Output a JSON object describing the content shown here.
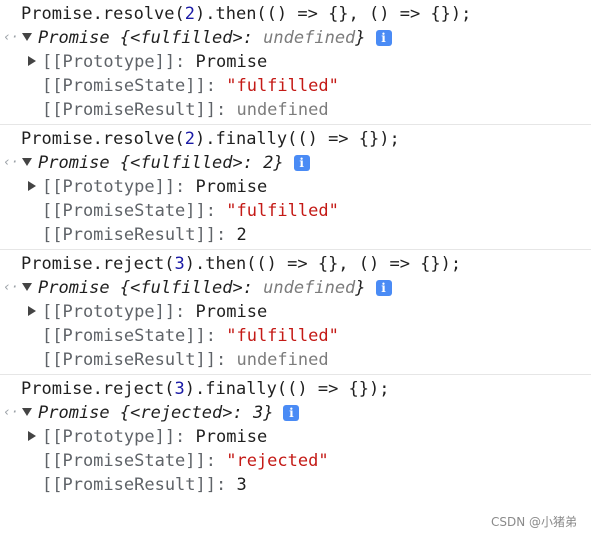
{
  "entries": [
    {
      "input_pre": "Promise.resolve(",
      "input_num": "2",
      "input_post": ").then(() => {}, () => {});",
      "result_prefix": "Promise {<fulfilled>: ",
      "result_value": "undefined",
      "result_suffix": "}",
      "prototype_key": "[[Prototype]]: ",
      "prototype_value": "Promise",
      "state_key": "[[PromiseState]]: ",
      "state_value": "\"fulfilled\"",
      "result_key": "[[PromiseResult]]: ",
      "result_val": "undefined"
    },
    {
      "input_pre": "Promise.resolve(",
      "input_num": "2",
      "input_post": ").finally(() => {});",
      "result_prefix": "Promise {<fulfilled>: ",
      "result_value": "2",
      "result_suffix": "}",
      "prototype_key": "[[Prototype]]: ",
      "prototype_value": "Promise",
      "state_key": "[[PromiseState]]: ",
      "state_value": "\"fulfilled\"",
      "result_key": "[[PromiseResult]]: ",
      "result_val": "2"
    },
    {
      "input_pre": "Promise.reject(",
      "input_num": "3",
      "input_post": ").then(() => {}, () => {});",
      "result_prefix": "Promise {<fulfilled>: ",
      "result_value": "undefined",
      "result_suffix": "}",
      "prototype_key": "[[Prototype]]: ",
      "prototype_value": "Promise",
      "state_key": "[[PromiseState]]: ",
      "state_value": "\"fulfilled\"",
      "result_key": "[[PromiseResult]]: ",
      "result_val": "undefined"
    },
    {
      "input_pre": "Promise.reject(",
      "input_num": "3",
      "input_post": ").finally(() => {});",
      "result_prefix": "Promise {<rejected>: ",
      "result_value": "3",
      "result_suffix": "}",
      "prototype_key": "[[Prototype]]: ",
      "prototype_value": "Promise",
      "state_key": "[[PromiseState]]: ",
      "state_value": "\"rejected\"",
      "result_key": "[[PromiseResult]]: ",
      "result_val": "3"
    }
  ],
  "info_icon_glyph": "i",
  "gutter_glyph": "‹·",
  "watermark": "CSDN @小猪弟",
  "colors": {
    "string": "#c41a16",
    "number": "#1a1aa6",
    "info_icon": "#4a8bf5",
    "muted": "#7c7c7c"
  }
}
